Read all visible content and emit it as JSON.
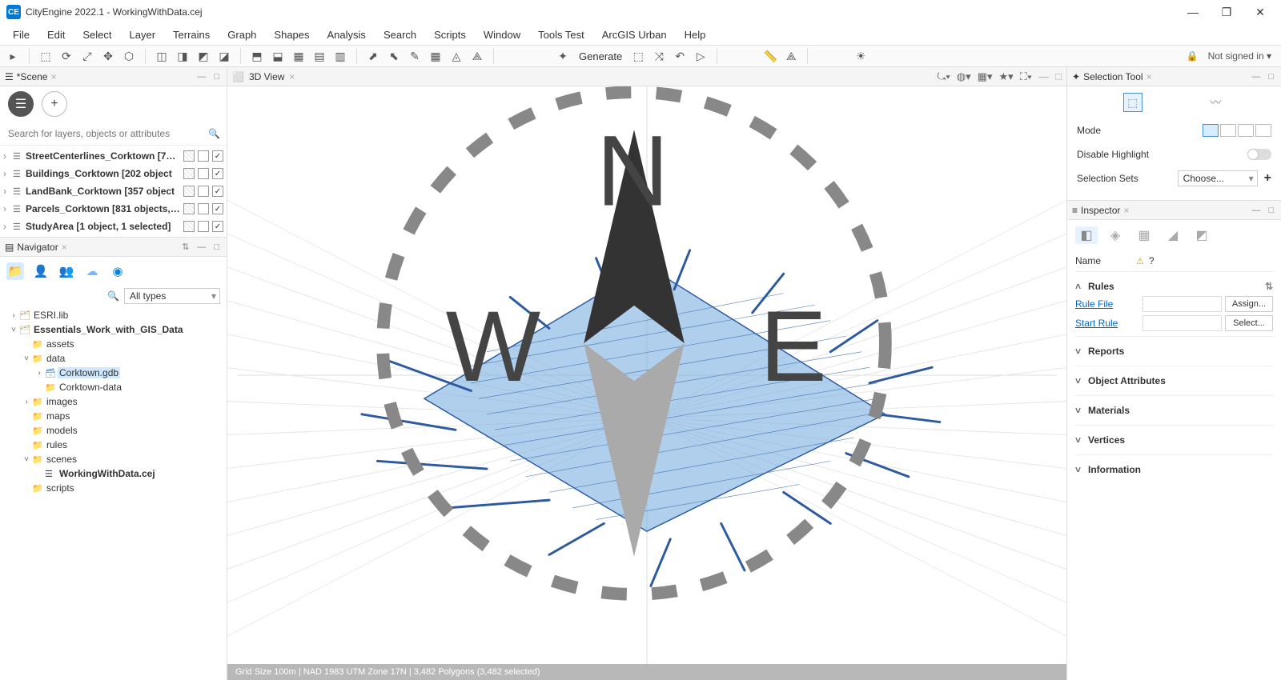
{
  "titlebar": {
    "title": "CityEngine 2022.1 - WorkingWithData.cej"
  },
  "menubar": [
    "File",
    "Edit",
    "Select",
    "Layer",
    "Terrains",
    "Graph",
    "Shapes",
    "Analysis",
    "Search",
    "Scripts",
    "Window",
    "Tools Test",
    "ArcGIS Urban",
    "Help"
  ],
  "toolbar": {
    "generate": "Generate",
    "signin": "Not signed in ▾"
  },
  "scene": {
    "tab": "*Scene",
    "search_placeholder": "Search for layers, objects or attributes",
    "layers": [
      {
        "name": "StreetCenterlines_Corktown [78…",
        "checked": true
      },
      {
        "name": "Buildings_Corktown [202 object",
        "checked": true
      },
      {
        "name": "LandBank_Corktown [357 object",
        "checked": true
      },
      {
        "name": "Parcels_Corktown [831 objects, …",
        "checked": true
      },
      {
        "name": "StudyArea [1 object, 1 selected]",
        "checked": true
      }
    ]
  },
  "navigator": {
    "title": "Navigator",
    "filter": "All types",
    "tree": [
      {
        "d": 0,
        "exp": ">",
        "ic": "lib",
        "label": "ESRI.lib"
      },
      {
        "d": 0,
        "exp": "v",
        "ic": "lib",
        "label": "Essentials_Work_with_GIS_Data",
        "bold": true
      },
      {
        "d": 1,
        "exp": "",
        "ic": "fld",
        "label": "assets"
      },
      {
        "d": 1,
        "exp": "v",
        "ic": "fld",
        "label": "data"
      },
      {
        "d": 2,
        "exp": ">",
        "ic": "gdb",
        "label": "Corktown.gdb",
        "sel": true
      },
      {
        "d": 2,
        "exp": "",
        "ic": "fld",
        "label": "Corktown-data"
      },
      {
        "d": 1,
        "exp": ">",
        "ic": "fld",
        "label": "images"
      },
      {
        "d": 1,
        "exp": "",
        "ic": "fld",
        "label": "maps"
      },
      {
        "d": 1,
        "exp": "",
        "ic": "fld",
        "label": "models"
      },
      {
        "d": 1,
        "exp": "",
        "ic": "fld",
        "label": "rules"
      },
      {
        "d": 1,
        "exp": "v",
        "ic": "fld",
        "label": "scenes"
      },
      {
        "d": 2,
        "exp": "",
        "ic": "scn",
        "label": "WorkingWithData.cej",
        "bold": true
      },
      {
        "d": 1,
        "exp": "",
        "ic": "fld",
        "label": "scripts"
      }
    ]
  },
  "view3d": {
    "tab": "3D View"
  },
  "statusbar": "Grid Size 100m  |  NAD 1983 UTM Zone 17N  |  3,482 Polygons  (3,482 selected)",
  "selection_tool": {
    "title": "Selection Tool",
    "mode_label": "Mode",
    "disable_highlight": "Disable Highlight",
    "sets_label": "Selection Sets",
    "sets_value": "Choose..."
  },
  "inspector": {
    "title": "Inspector",
    "name_label": "Name",
    "name_value": "?",
    "rules_hdr": "Rules",
    "rule_file": "Rule File",
    "start_rule": "Start Rule",
    "assign": "Assign...",
    "select": "Select...",
    "sections": [
      "Reports",
      "Object Attributes",
      "Materials",
      "Vertices",
      "Information"
    ]
  }
}
